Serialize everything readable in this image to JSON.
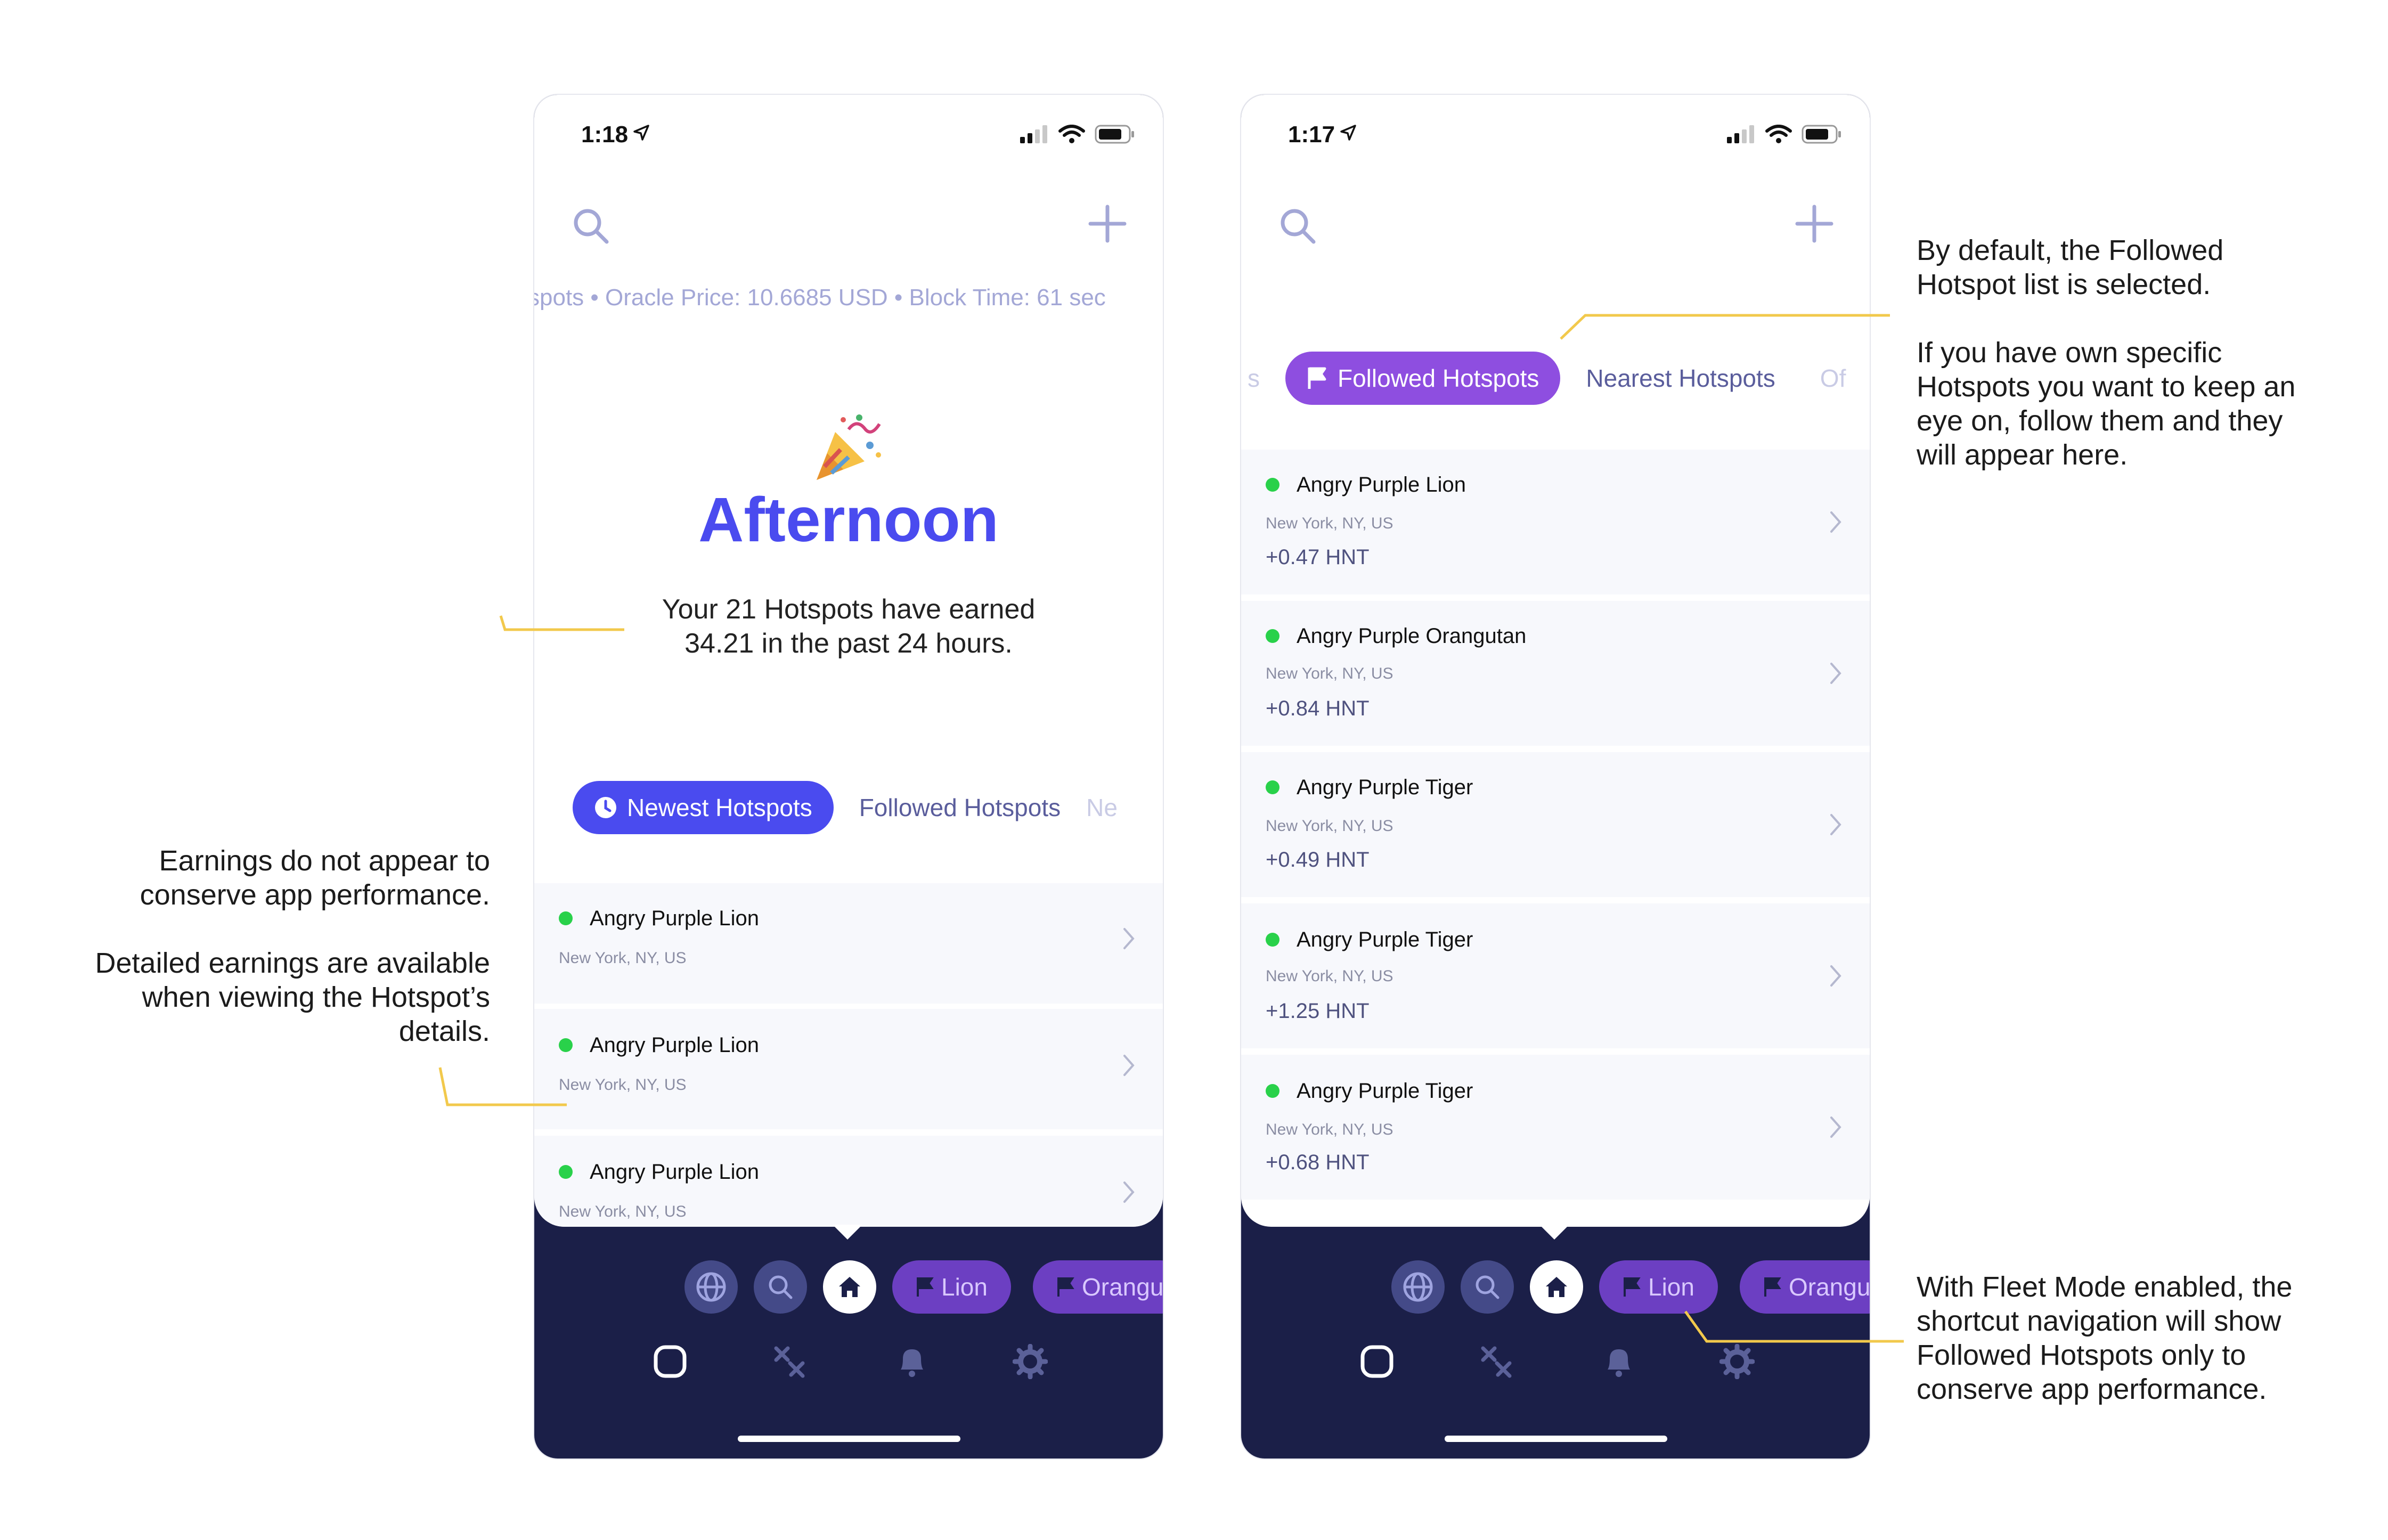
{
  "colors": {
    "accent_blue": "#4a4bef",
    "accent_purple": "#8e4ee0",
    "nav_dark": "#1b1f48",
    "online_green": "#29d14a",
    "callout_line": "#f2c94c"
  },
  "left_phone": {
    "status_time": "1:18",
    "ticker": "spots • Oracle Price: 10.6685 USD • Block Time: 61 sec",
    "emoji": "party-popper-icon",
    "greeting": "Afternoon",
    "summary_line1": "Your 21 Hotspots have earned",
    "summary_line2": "34.21 in the past 24 hours.",
    "tabs": [
      {
        "label": "Newest Hotspots",
        "icon": "clock-icon",
        "active": true
      },
      {
        "label": "Followed Hotspots",
        "active": false
      },
      {
        "label": "Ne",
        "active": false
      }
    ],
    "items": [
      {
        "name": "Angry Purple Lion",
        "location": "New York, NY, US"
      },
      {
        "name": "Angry Purple Lion",
        "location": "New York, NY, US"
      },
      {
        "name": "Angry Purple Lion",
        "location": "New York, NY, US"
      }
    ],
    "shortcuts": [
      {
        "label": "Lion",
        "icon": "flag-icon"
      },
      {
        "label": "Orangu",
        "icon": "flag-icon"
      }
    ]
  },
  "right_phone": {
    "status_time": "1:17",
    "tabs": [
      {
        "label": "s",
        "active": false
      },
      {
        "label": "Followed Hotspots",
        "icon": "flag-icon",
        "active": true
      },
      {
        "label": "Nearest Hotspots",
        "active": false
      },
      {
        "label": "Of",
        "active": false
      }
    ],
    "items": [
      {
        "name": "Angry Purple Lion",
        "location": "New York, NY, US",
        "earnings": "+0.47 HNT"
      },
      {
        "name": "Angry Purple Orangutan",
        "location": "New York, NY, US",
        "earnings": "+0.84 HNT"
      },
      {
        "name": "Angry Purple Tiger",
        "location": "New York, NY, US",
        "earnings": "+0.49 HNT"
      },
      {
        "name": "Angry Purple Tiger",
        "location": "New York, NY, US",
        "earnings": "+1.25 HNT"
      },
      {
        "name": "Angry Purple Tiger",
        "location": "New York, NY, US",
        "earnings": "+0.68 HNT"
      }
    ],
    "shortcuts": [
      {
        "label": "Lion",
        "icon": "flag-icon"
      },
      {
        "label": "Orangu",
        "icon": "flag-icon"
      }
    ]
  },
  "annotations": {
    "earnings_note": {
      "p1_line1": "Earnings do not appear to",
      "p1_line2": "conserve app performance.",
      "p2_line1": "Detailed earnings are available",
      "p2_line2": "when viewing the Hotspot’s",
      "p2_line3": "details."
    },
    "followed_note": {
      "p1_line1": "By default, the Followed",
      "p1_line2": "Hotspot list is selected.",
      "p2_line1": "If you have own specific",
      "p2_line2": "Hotspots you want to keep an",
      "p2_line3": "eye on, follow them and they",
      "p2_line4": "will appear here."
    },
    "fleet_note": {
      "line1": "With Fleet Mode enabled, the",
      "line2": "shortcut navigation will show",
      "line3": "Followed Hotspots only to",
      "line4": "conserve app performance."
    }
  }
}
